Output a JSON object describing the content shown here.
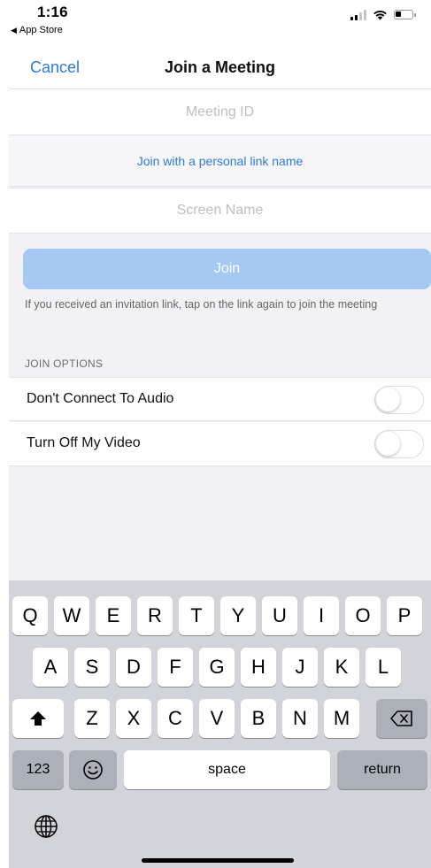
{
  "status_bar": {
    "time": "1:16",
    "back_label": "App Store"
  },
  "nav": {
    "cancel": "Cancel",
    "title": "Join a Meeting"
  },
  "meeting_id": {
    "value": "",
    "placeholder": "Meeting ID"
  },
  "personal_link": {
    "label": "Join with a personal link name"
  },
  "screen_name": {
    "value": "",
    "placeholder": "Screen Name"
  },
  "join_button": {
    "label": "Join",
    "color": "#a5c9f3"
  },
  "hint": "If you received an invitation link, tap on the link again to join the meeting",
  "join_options": {
    "header": "JOIN OPTIONS",
    "items": [
      {
        "label": "Don't Connect To Audio",
        "on": false
      },
      {
        "label": "Turn Off My Video",
        "on": false
      }
    ]
  },
  "keyboard": {
    "row1": [
      "Q",
      "W",
      "E",
      "R",
      "T",
      "Y",
      "U",
      "I",
      "O",
      "P"
    ],
    "row2": [
      "A",
      "S",
      "D",
      "F",
      "G",
      "H",
      "J",
      "K",
      "L"
    ],
    "row3": [
      "Z",
      "X",
      "C",
      "V",
      "B",
      "N",
      "M"
    ],
    "numbers": "123",
    "space": "space",
    "return": "return",
    "icons": {
      "shift": "shift-icon",
      "delete": "delete-icon",
      "emoji": "emoji-icon",
      "globe": "globe-icon"
    }
  },
  "colors": {
    "accent": "#2d7ad8",
    "background": "#f2f2f4",
    "keyboard": "#d2d4da"
  }
}
